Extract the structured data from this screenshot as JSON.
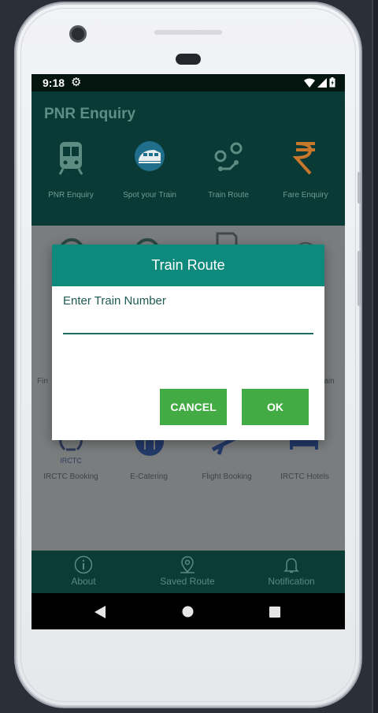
{
  "status_bar": {
    "time": "9:18"
  },
  "header": {
    "title": "PNR Enquiry"
  },
  "top_menu": [
    {
      "label": "PNR Enquiry",
      "icon": "train-front-icon"
    },
    {
      "label": "Spot your Train",
      "icon": "bullet-train-icon"
    },
    {
      "label": "Train Route",
      "icon": "route-icon"
    },
    {
      "label": "Fare Enquiry",
      "icon": "rupee-icon"
    }
  ],
  "grid": {
    "partial_left": "Fin",
    "partial_right": "rain",
    "irctc_logo": "IRCTC",
    "items": [
      "IRCTC Booking",
      "E-Catering",
      "Flight Booking",
      "IRCTC Hotels"
    ]
  },
  "bottom_nav": [
    {
      "label": "About",
      "icon": "info-icon"
    },
    {
      "label": "Saved Route",
      "icon": "location-pin-icon"
    },
    {
      "label": "Notification",
      "icon": "bell-icon"
    }
  ],
  "dialog": {
    "title": "Train Route",
    "field_label": "Enter Train Number",
    "input_value": "",
    "cancel_label": "CANCEL",
    "ok_label": "OK"
  },
  "colors": {
    "header_bg": "#0a3a35",
    "dialog_header": "#0e8a7d",
    "button_green": "#42ab43",
    "orange_rupee": "#c8772c"
  }
}
